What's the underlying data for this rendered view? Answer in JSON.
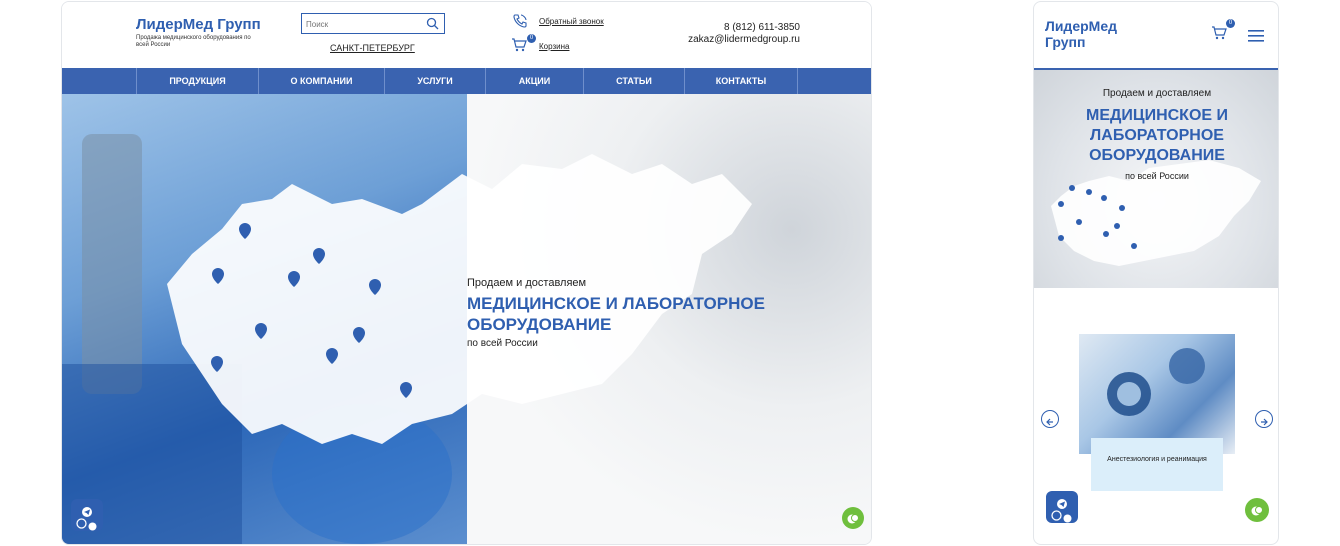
{
  "desktop": {
    "logo": {
      "title": "ЛидерМед Групп",
      "subtitle": "Продажа медицинского оборудования по всей России"
    },
    "search": {
      "placeholder": "Поиск"
    },
    "city": "САНКТ-ПЕТЕРБУРГ",
    "callback": "Обратный звонок",
    "cart": {
      "label": "Корзина",
      "count": "0"
    },
    "contacts": {
      "phone": "8 (812) 611-3850",
      "email": "zakaz@lidermedgroup.ru"
    },
    "nav": [
      {
        "label": "ПРОДУКЦИЯ"
      },
      {
        "label": "О КОМПАНИИ"
      },
      {
        "label": "УСЛУГИ"
      },
      {
        "label": "АКЦИИ"
      },
      {
        "label": "СТАТЬИ"
      },
      {
        "label": "КОНТАКТЫ"
      }
    ],
    "hero": {
      "lead": "Продаем и доставляем",
      "headline": "МЕДИЦИНСКОЕ И ЛАБОРАТОРНОЕ ОБОРУДОВАНИЕ",
      "sub": "по всей России"
    }
  },
  "mobile": {
    "logo": "ЛидерМед Групп",
    "cart_count": "0",
    "hero": {
      "lead": "Продаем и доставляем",
      "headline": "МЕДИЦИНСКОЕ И ЛАБОРАТОРНОЕ ОБОРУДОВАНИЕ",
      "sub": "по всей России"
    },
    "card": {
      "label": "Анестезиология и реанимация"
    }
  },
  "colors": {
    "brand": "#2f5fb0",
    "nav": "#3a63b0",
    "chat": "#6fbf3d",
    "card": "#dbeefa"
  }
}
